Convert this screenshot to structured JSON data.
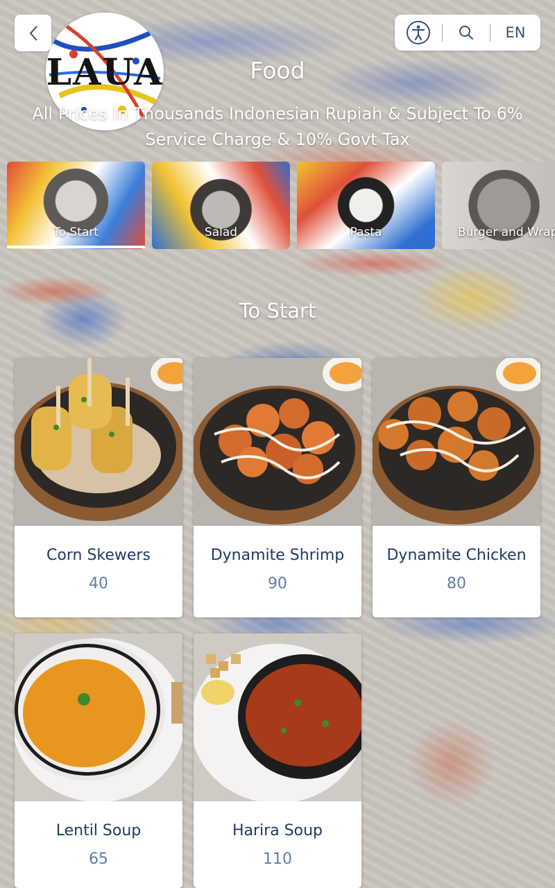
{
  "header": {
    "logo_text": "LAUA",
    "language": "EN",
    "title": "Food",
    "subtitle": "All Prices In Thousands Indonesian Rupiah & Subject To 6% Service Charge & 10% Govt Tax"
  },
  "categories": [
    {
      "label": "To Start",
      "icon": "monkey-image"
    },
    {
      "label": "Salad",
      "icon": "tiger-image"
    },
    {
      "label": "Pasta",
      "icon": "red-panda-image"
    },
    {
      "label": "Burger and Wraps",
      "icon": "elephant-image"
    }
  ],
  "section": {
    "title": "To Start"
  },
  "items": [
    {
      "name": "Corn Skewers",
      "price": "40"
    },
    {
      "name": "Dynamite Shrimp",
      "price": "90"
    },
    {
      "name": "Dynamite Chicken",
      "price": "80"
    },
    {
      "name": "Lentil Soup",
      "price": "65"
    },
    {
      "name": "Harira Soup",
      "price": "110"
    }
  ],
  "colors": {
    "accent": "#1e3a63",
    "price": "#5c7ea8"
  }
}
